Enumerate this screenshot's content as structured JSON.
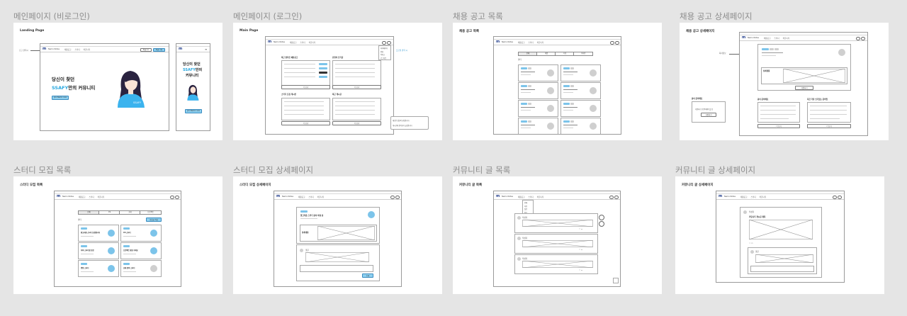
{
  "sections": [
    {
      "title": "메인페이지 (비로그인)",
      "frame_label": "Landing Page"
    },
    {
      "title": "메인페이지 (로그인)",
      "frame_label": "Main Page"
    },
    {
      "title": "채용 공고 목록",
      "frame_label": "채용 공고 목록"
    },
    {
      "title": "채용 공고 상세페이지",
      "frame_label": "채용 공고 상세페이지"
    },
    {
      "title": "스터디 모집 목록",
      "frame_label": "스터디 모집 목록"
    },
    {
      "title": "스터디 모집 상세페이지",
      "frame_label": "스터디 모집 상세페이지"
    },
    {
      "title": "커뮤니티 글 목록",
      "frame_label": "커뮤니티 글 목록"
    },
    {
      "title": "커뮤니티 글 상세페이지",
      "frame_label": "커뮤니티 글 상세페이지"
    }
  ],
  "nav": {
    "logo": "m",
    "brand": "Nemo Notes",
    "links": [
      "채용공고",
      "스터디",
      "커뮤니티"
    ],
    "login": "Sign in",
    "signup": "Sign Up"
  },
  "landing": {
    "annotation": "로고 클릭시",
    "hero_line1": "당신이 찾던",
    "hero_accent": "SSAFY",
    "hero_line2_rest": "만의 커뮤니티",
    "cta": "Join Nemo now",
    "avatar_tag": "SSAFY",
    "mobile_line1": "당신이 찾던",
    "mobile_accent": "SSAFY",
    "mobile_line2_rest": "만의",
    "mobile_line3": "커뮤니티"
  },
  "main": {
    "panels": [
      "최근 올라온 채용공고",
      "유형의 인기글",
      "스터디 모집 게시판",
      "최근 게시글"
    ],
    "more": "더 보기",
    "dropdown": [
      "마이페이지",
      "알림",
      "북마크",
      "로그아웃"
    ],
    "side_note": "프로필 클릭 시",
    "toast_lines": [
      "새로운 댓글이 달렸습니다",
      "게시글에 좋아요가 눌렸습니다"
    ]
  },
  "jobs": {
    "tabs": [
      "전체",
      "개발",
      "기획",
      "디자인"
    ],
    "filter": "필터"
  },
  "job_detail": {
    "annotation": "회사정보",
    "section_title": "상세내용",
    "side_title": "같이 준비해요",
    "side_box_text": "지원하기 전 준비해야 할 것",
    "side_btn": "지원하기",
    "lists": [
      "같이 준비해요",
      "지금 가장 인기있는 준비팁"
    ],
    "more": "더 보기"
  },
  "study": {
    "tabs": [
      "전체",
      "CS",
      "코테",
      "프로젝트"
    ],
    "write": "모집글 작성",
    "filter": "필터",
    "cards": [
      "알고리즘 스터디 모집합니다",
      "CS 스터디",
      "자바 스터디원 모집",
      "프로젝트 팀원 구해요",
      "면접 스터디",
      "코테 준비 스터디"
    ]
  },
  "study_detail": {
    "title": "알고리즘 스터디 같이 하실 분",
    "section_title": "상세내용",
    "comment_label": "댓글",
    "submit": "등록"
  },
  "community": {
    "dropdown": [
      "전체",
      "자유",
      "질문",
      "정보"
    ],
    "author": "작성자"
  },
  "community_detail": {
    "author": "작성자",
    "title": "커뮤니티 게시글 제목",
    "comment_label": "댓글"
  }
}
